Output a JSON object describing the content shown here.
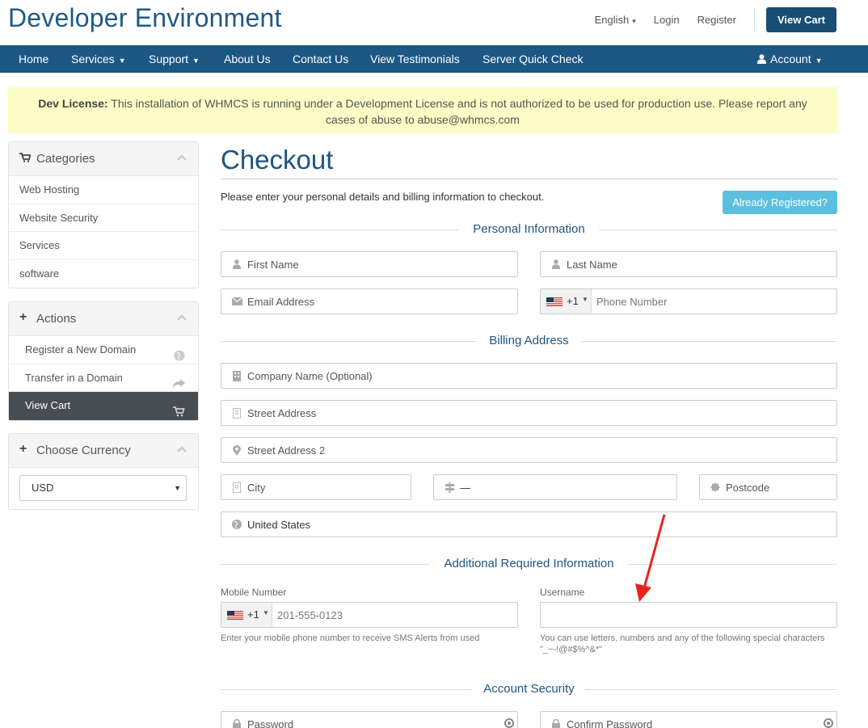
{
  "header": {
    "brand": "Developer Environment",
    "language": "English",
    "login": "Login",
    "register": "Register",
    "view_cart": "View Cart"
  },
  "nav": {
    "items": [
      {
        "label": "Home",
        "dropdown": false
      },
      {
        "label": "Services",
        "dropdown": true
      },
      {
        "label": "Support",
        "dropdown": true
      },
      {
        "label": "About Us",
        "dropdown": false
      },
      {
        "label": "Contact Us",
        "dropdown": false
      },
      {
        "label": "View Testimonials",
        "dropdown": false
      },
      {
        "label": "Server Quick Check",
        "dropdown": false
      }
    ],
    "account": "Account"
  },
  "banner": {
    "strong": "Dev License:",
    "text": "This installation of WHMCS is running under a Development License and is not authorized to be used for production use. Please report any cases of abuse to abuse@whmcs.com"
  },
  "sidebar": {
    "categories": {
      "title": "Categories",
      "items": [
        "Web Hosting",
        "Website Security",
        "Services",
        "software"
      ]
    },
    "actions": {
      "title": "Actions",
      "items": [
        {
          "label": "Register a New Domain",
          "icon": "globe-icon"
        },
        {
          "label": "Transfer in a Domain",
          "icon": "share-arrow-icon"
        },
        {
          "label": "View Cart",
          "icon": "cart-icon",
          "active": true
        }
      ]
    },
    "currency": {
      "title": "Choose Currency",
      "selected": "USD"
    }
  },
  "checkout": {
    "title": "Checkout",
    "intro": "Please enter your personal details and billing information to checkout.",
    "already_registered": "Already Registered?",
    "personal": {
      "heading": "Personal Information",
      "first_name": "First Name",
      "last_name": "Last Name",
      "email": "Email Address",
      "phone_code": "+1",
      "phone": "Phone Number"
    },
    "billing": {
      "heading": "Billing Address",
      "company": "Company Name (Optional)",
      "street": "Street Address",
      "street2": "Street Address 2",
      "city": "City",
      "state": "—",
      "postcode": "Postcode",
      "country": "United States"
    },
    "additional": {
      "heading": "Additional Required Information",
      "mobile_label": "Mobile Number",
      "mobile_code": "+1",
      "mobile_placeholder": "201-555-0123",
      "mobile_help": "Enter your mobile phone number to receive SMS Alerts from used",
      "username_label": "Username",
      "username_help": "You can use letters, numbers and any of the following special characters \"_~-!@#$%^&*\""
    },
    "security": {
      "heading": "Account Security",
      "password": "Password",
      "confirm_password": "Confirm Password"
    }
  },
  "colors": {
    "brand": "#1f5a86",
    "navbar": "#1d5784",
    "banner": "#fdfcc6",
    "info_button": "#5bc0de",
    "annotation_arrow": "#e8231d"
  }
}
